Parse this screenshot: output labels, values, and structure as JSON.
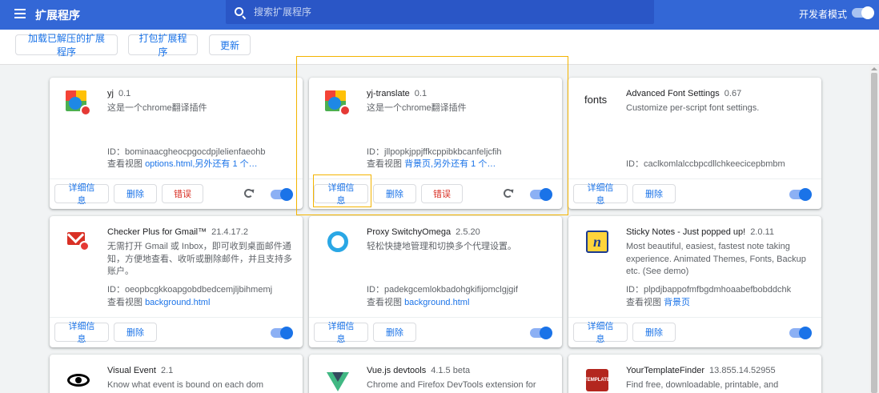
{
  "header": {
    "title": "扩展程序",
    "search_placeholder": "搜索扩展程序",
    "dev_mode_label": "开发者模式",
    "dev_mode_on": true
  },
  "toolbar": {
    "load_unpacked": "加载已解压的扩展程序",
    "pack": "打包扩展程序",
    "update": "更新"
  },
  "common": {
    "details": "详细信息",
    "remove": "删除",
    "errors": "错误",
    "id_prefix": "ID：",
    "views_prefix": "查看视图"
  },
  "extensions": [
    {
      "name": "yj",
      "version": "0.1",
      "desc": "这是一个chrome翻译插件",
      "id": "bominaacgheocpgocdpjlelienfaeohb",
      "views": "options.html,另外还有 1 个…",
      "enabled": true
    },
    {
      "name": "yj-translate",
      "version": "0.1",
      "desc": "这是一个chrome翻译插件",
      "id": "jllpopkjppjffkcppibkbcanfeljcfih",
      "views": "背景页,另外还有 1 个…",
      "enabled": true
    },
    {
      "name": "Advanced Font Settings",
      "version": "0.67",
      "desc": "Customize per-script font settings.",
      "id": "caclkomlalccbpcdllchkeecicepbmbm",
      "views": "",
      "icon_text": "fonts",
      "enabled": true
    },
    {
      "name": "Checker Plus for Gmail™",
      "version": "21.4.17.2",
      "desc": "无需打开 Gmail 或 Inbox，即可收到桌面邮件通知，方便地查看、收听或删除邮件，并且支持多账户。",
      "id": "oeopbcgkkoapgobdbedcemjljbihmemj",
      "views": "background.html",
      "enabled": true
    },
    {
      "name": "Proxy SwitchyOmega",
      "version": "2.5.20",
      "desc": "轻松快捷地管理和切换多个代理设置。",
      "id": "padekgcemlokbadohgkifijomclgjgif",
      "views": "background.html",
      "enabled": true
    },
    {
      "name": "Sticky Notes - Just popped up!",
      "version": "2.0.11",
      "desc": "Most beautiful, easiest, fastest note taking experience. Animated Themes, Fonts, Backup etc. (See demo)",
      "id": "plpdjbappofmfbgdmhoaabefbobddchk",
      "views": "背景页",
      "icon_text": "n",
      "enabled": true
    },
    {
      "name": "Visual Event",
      "version": "2.1",
      "desc": "Know what event is bound on each dom element"
    },
    {
      "name": "Vue.js devtools",
      "version": "4.1.5 beta",
      "desc": "Chrome and Firefox DevTools extension for"
    },
    {
      "name": "YourTemplateFinder",
      "version": "13.855.14.52955",
      "desc": "Find free, downloadable, printable, and",
      "icon_text": "TEMPLATE"
    }
  ],
  "colors": {
    "header_bg": "#3367d6",
    "accent": "#1a73e8",
    "error": "#d93025",
    "highlight": "#f4b400"
  }
}
